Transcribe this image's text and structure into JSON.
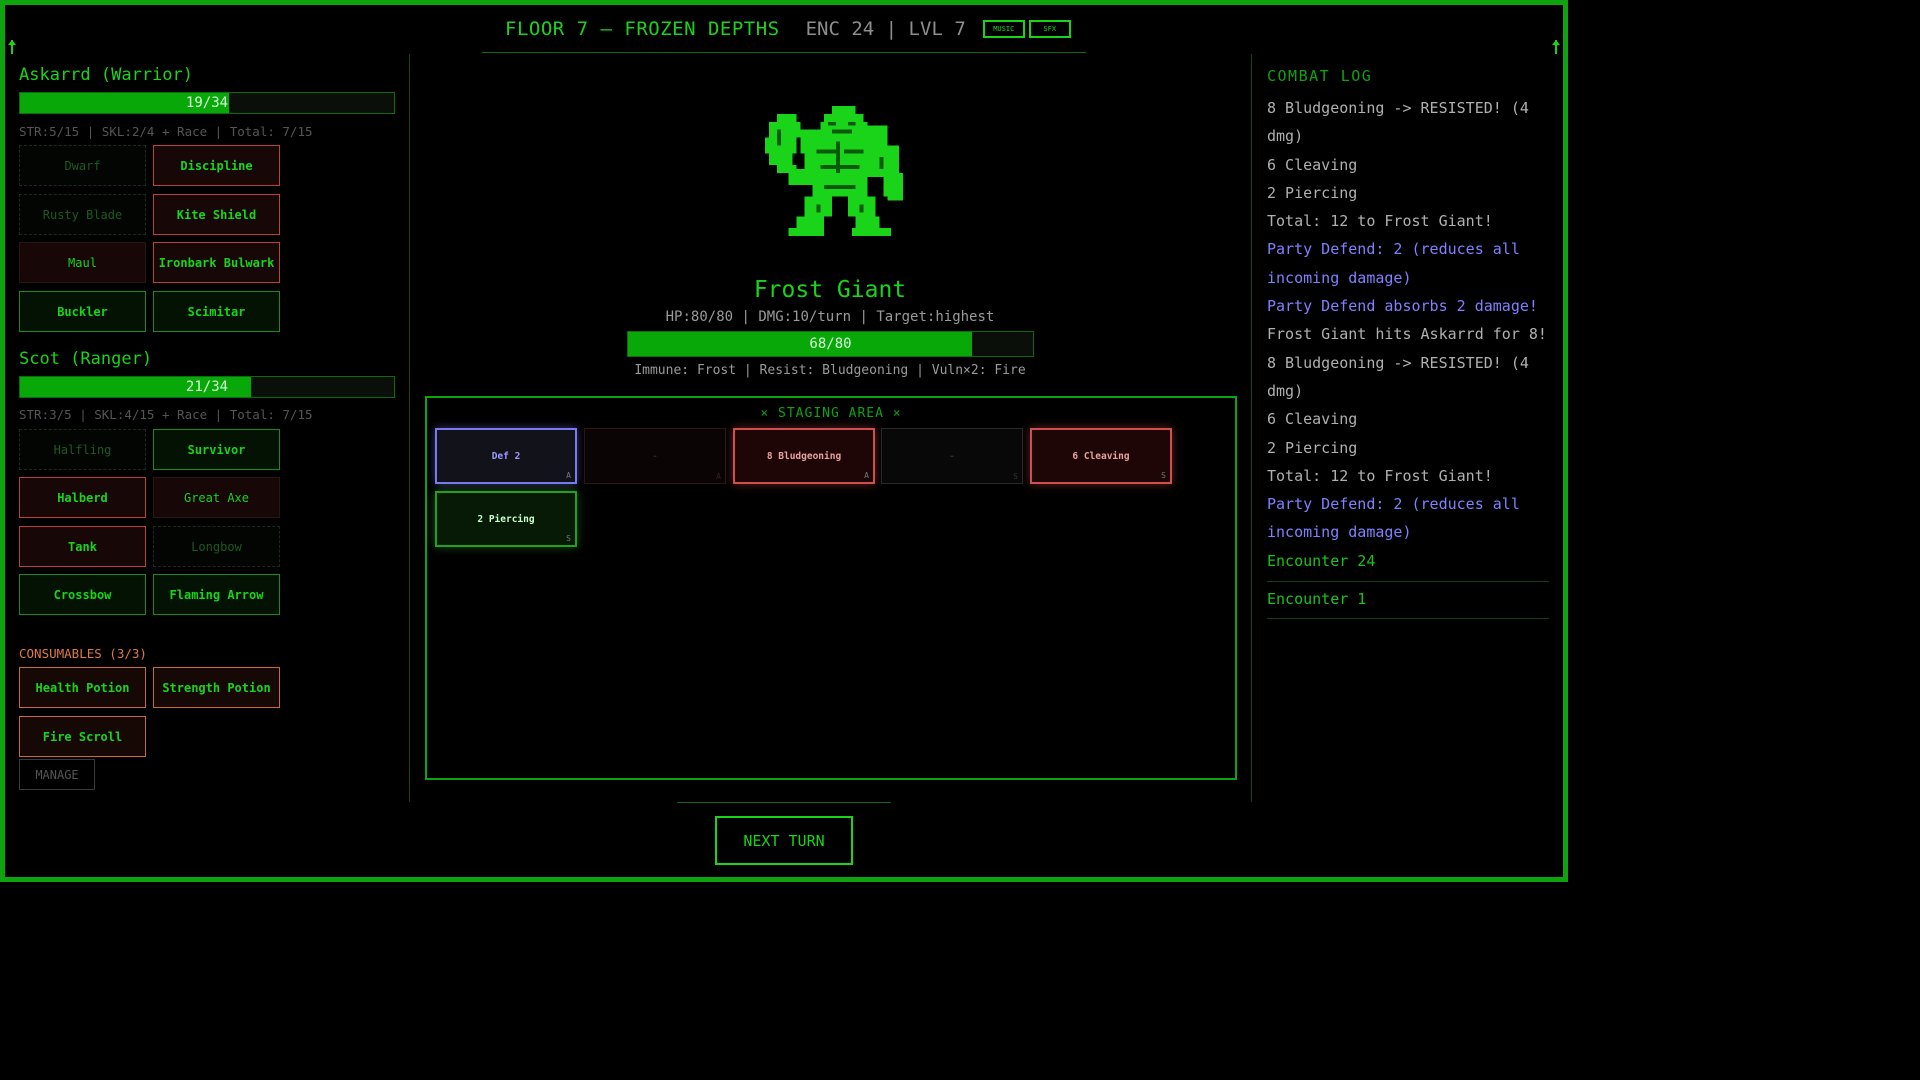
{
  "header": {
    "floor_title": "FLOOR 7 — FROZEN DEPTHS",
    "encounter_info": "ENC 24 | LVL 7",
    "music_label": "MUSIC",
    "sfx_label": "SFX"
  },
  "party": [
    {
      "name": "Askarrd (Warrior)",
      "hp_text": "19/34",
      "hp_fraction": 0.559,
      "stats": "STR:5/15 | SKL:2/4 + Race | Total: 7/15",
      "cards": [
        "Dwarf",
        "Discipline",
        "Rusty Blade",
        "Kite Shield",
        "Maul",
        "Ironbark Bulwark",
        "Buckler",
        "Scimitar"
      ]
    },
    {
      "name": "Scot (Ranger)",
      "hp_text": "21/34",
      "hp_fraction": 0.618,
      "stats": "STR:3/5 | SKL:4/15 + Race | Total: 7/15",
      "cards": [
        "Halfling",
        "Survivor",
        "Halberd",
        "Great Axe",
        "Tank",
        "Longbow",
        "Crossbow",
        "Flaming Arrow"
      ]
    }
  ],
  "consumables": {
    "title": "CONSUMABLES (3/3)",
    "items": [
      "Health Potion",
      "Strength Potion",
      "Fire Scroll"
    ],
    "manage_label": "MANAGE"
  },
  "enemy": {
    "name": "Frost Giant",
    "stats": "HP:80/80 | DMG:10/turn | Target:highest",
    "hp_text": "68/80",
    "hp_fraction": 0.85,
    "traits": "Immune: Frost | Resist: Bludgeoning | Vuln×2: Fire",
    "sprite": "frost-giant-pixel-sprite",
    "sprite_color": "#19d419"
  },
  "staging": {
    "title": "⨯ STAGING AREA ⨯",
    "slots": [
      {
        "label": "Def 2",
        "tag": "A"
      },
      {
        "label": "-",
        "tag": "A"
      },
      {
        "label": "8 Bludgeoning",
        "tag": "A"
      },
      {
        "label": "-",
        "tag": "S"
      },
      {
        "label": "6 Cleaving",
        "tag": "S"
      },
      {
        "label": "2 Piercing",
        "tag": "S"
      }
    ]
  },
  "next_turn_label": "NEXT TURN",
  "combat_log": {
    "title": "COMBAT LOG",
    "lines": [
      "8 Bludgeoning -> RESISTED! (4 dmg)",
      "6 Cleaving",
      "2 Piercing",
      "Total: 12 to Frost Giant!",
      "Party Defend: 2 (reduces all incoming damage)",
      "Party Defend absorbs 2 damage!",
      "Frost Giant hits Askarrd for 8!",
      "8 Bludgeoning -> RESISTED! (4 dmg)",
      "6 Cleaving",
      "2 Piercing",
      "Total: 12 to Frost Giant!",
      "Party Defend: 2 (reduces all incoming damage)",
      "Encounter 24"
    ],
    "encounters": [
      "Encounter 1"
    ]
  },
  "colors": {
    "accent": "#19d419",
    "defend": "#8080ff",
    "attack": "#d05050",
    "consumable": "#e07a40"
  }
}
